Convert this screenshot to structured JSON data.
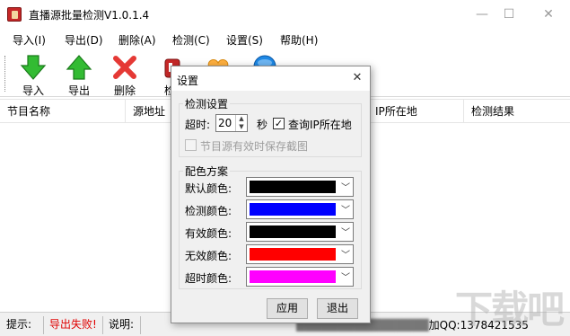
{
  "window": {
    "title": "直播源批量检测V1.0.1.4",
    "controls": {
      "minimize": "—",
      "maximize": "☐",
      "close": "✕"
    }
  },
  "menu": [
    "导入(I)",
    "导出(D)",
    "删除(A)",
    "检测(C)",
    "设置(S)",
    "帮助(H)"
  ],
  "toolbar": {
    "import": {
      "label": "导入",
      "icon": "import-arrow-down-icon",
      "color": "#2fb32f"
    },
    "export": {
      "label": "导出",
      "icon": "export-arrow-up-icon",
      "color": "#2fb32f"
    },
    "delete": {
      "label": "删除",
      "icon": "delete-x-icon",
      "color": "#e53935"
    },
    "check": {
      "label": "检",
      "icon": "check-icon",
      "color": "#c62828"
    }
  },
  "list": {
    "columns": [
      "节目名称",
      "源地址",
      "IP所在地",
      "检测结果"
    ]
  },
  "status": {
    "hint_label": "提示:",
    "hint_value": "导出失败!",
    "desc_label": "说明:",
    "qq_tail": "加QQ:1378421535"
  },
  "watermark": "下载吧",
  "dialog": {
    "title": "设置",
    "close": "✕",
    "detect_group": {
      "title": "检测设置",
      "timeout_label": "超时:",
      "timeout_value": "20",
      "timeout_unit": "秒",
      "query_ip": {
        "label": "查询IP所在地",
        "checked": true
      },
      "save_screenshot": {
        "label": "节目源有效时保存截图",
        "checked": false,
        "enabled": false
      }
    },
    "color_group": {
      "title": "配色方案",
      "items": [
        {
          "label": "默认颜色:",
          "color": "#000000"
        },
        {
          "label": "检测颜色:",
          "color": "#0000ff"
        },
        {
          "label": "有效颜色:",
          "color": "#000000"
        },
        {
          "label": "无效颜色:",
          "color": "#ff0000"
        },
        {
          "label": "超时颜色:",
          "color": "#ff00ff"
        }
      ]
    },
    "buttons": {
      "apply": "应用",
      "exit": "退出"
    }
  }
}
